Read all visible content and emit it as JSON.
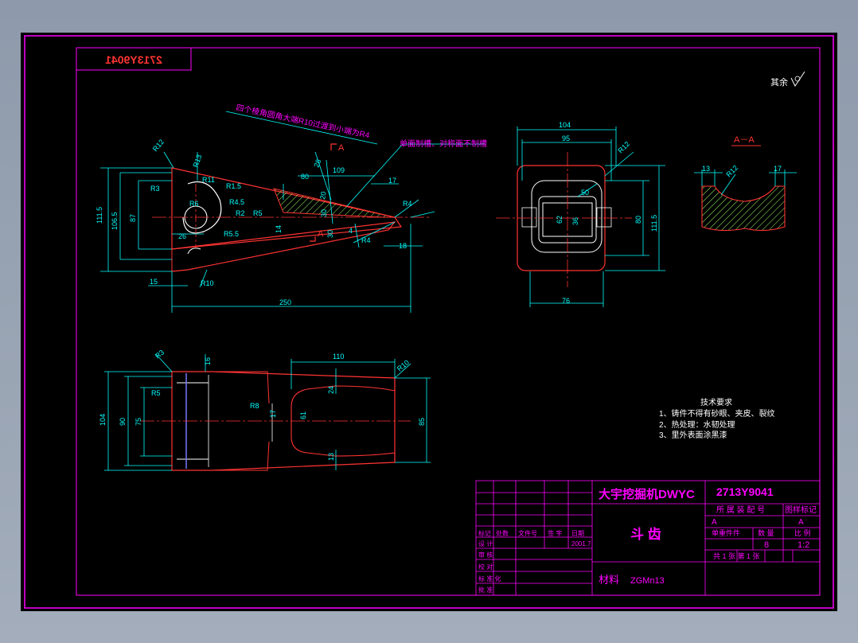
{
  "colors": {
    "background": "#000000",
    "frame": "#ff00ff",
    "part_outline": "#ff3333",
    "dimension": "#00ffff",
    "hatch": "#99ff66",
    "text_white": "#ffffff",
    "text_blue": "#7777ff",
    "centerline": "#ff3333"
  },
  "drawing": {
    "mirrored_code": "2713Y9041",
    "surface_note": "其余",
    "note_fillet": "四个棱角圆角大端R10过渡到小端为R4",
    "note_slot": "单面制槽、对称面不制槽",
    "section_label": "A－A",
    "cut_label_a": "A",
    "cut_label_b": "A",
    "side_view_dims": {
      "d111_5": "111.5",
      "d106_5": "106.5",
      "d87": "87",
      "d250": "250",
      "d26": "26",
      "d15": "15",
      "d80": "80",
      "d109": "109",
      "d17": "17",
      "d18": "18",
      "d14": "14",
      "r10": "R10",
      "r4": "R4",
      "r4b": "R4",
      "r12": "R12",
      "r13": "R13",
      "r3": "R3",
      "r11": "R11",
      "r1_5": "R1.5",
      "r4_5": "R4.5",
      "r5_5": "R5.5",
      "r5": "R5",
      "r2": "R2",
      "r6": "R6",
      "d28": "28",
      "d20": "20",
      "d30": "30",
      "d30b": "30",
      "d4": "4"
    },
    "front_view_dims": {
      "d104": "104",
      "d95": "95",
      "d76": "76",
      "d80": "80",
      "d111_5": "111.5",
      "d62": "62",
      "r12": "R12",
      "d36": "36",
      "d50": "50"
    },
    "section_dims": {
      "d13": "13",
      "d17": "17",
      "r12": "R12"
    },
    "top_view_dims": {
      "d104": "104",
      "d90": "90",
      "d75": "75",
      "d110": "110",
      "d16": "16",
      "d85": "85",
      "d24": "24",
      "d13": "13",
      "d17": "17",
      "r3": "R3",
      "r10": "R10",
      "r8": "R8",
      "r5": "R5",
      "d61": "61"
    }
  },
  "tech_requirements": {
    "title": "技术要求",
    "items": [
      "1、铸件不得有砂眼、夹皮、裂纹",
      "2、热处理：水韧处理",
      "3、里外表面涂黑漆"
    ]
  },
  "title_block": {
    "company": "大宇挖掘机DWYC",
    "drawing_number": "2713Y9041",
    "part_name": "斗 齿",
    "material_label": "材料",
    "material_value": "ZGMn13",
    "hdr_assembly": "所 属 装 配 号",
    "hdr_drawing_mark": "图样标记",
    "mark_a": "A",
    "mark_a2": "A",
    "hdr_single_weight": "单重件件",
    "hdr_qty": "数 量",
    "hdr_scale": "比 例",
    "qty_value": "8",
    "scale_value": "1:2",
    "sheets_row": "共 1 张    第 1 张",
    "rev_headers": [
      "标记",
      "处数",
      "文件号",
      "签 字",
      "日期"
    ],
    "date_value": "2001.7",
    "rows": [
      "设    计",
      "审    核",
      "校    对",
      "标 准 化",
      "批    准"
    ]
  }
}
